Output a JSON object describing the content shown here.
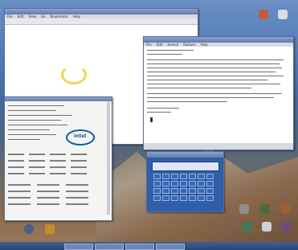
{
  "app_menu": {
    "items": [
      "File",
      "Edit",
      "View",
      "Go",
      "Bookmarks",
      "Help"
    ]
  },
  "system_window": {
    "logo_text": "intel"
  },
  "editor_window": {
    "menu": [
      "File",
      "Edit",
      "Search",
      "Options",
      "Help"
    ]
  },
  "colors": {
    "desktop_top": "#6a8fc4",
    "title_bar": "#6d89c0",
    "calculator_display": "#dfe7f7",
    "intel_blue": "#0a5ca8"
  },
  "icons": [
    "trash-icon",
    "home-icon",
    "computer-icon",
    "folder-icon",
    "network-icon"
  ]
}
